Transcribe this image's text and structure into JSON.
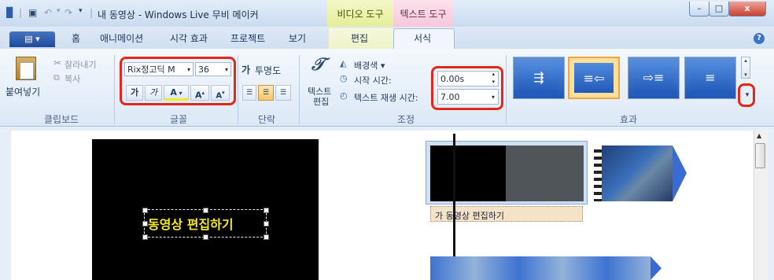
{
  "window": {
    "title": "내 동영상 - Windows Live 무비 메이커",
    "context_video": "비디오 도구",
    "context_text": "텍스트 도구",
    "min": "–",
    "max": "□",
    "close": "x"
  },
  "tabs": {
    "file": "▤ ▾",
    "home": "홈",
    "animation": "애니메이션",
    "visual_effects": "시각 효과",
    "project": "프로젝트",
    "view": "보기",
    "edit": "편집",
    "format": "서식",
    "help": "?"
  },
  "clipboard": {
    "paste": "붙여넣기",
    "cut": "잘라내기",
    "copy": "복사",
    "label": "클립보드"
  },
  "font": {
    "family": "Rix정고딕 M",
    "size": "36",
    "grow": "가",
    "shrink": "가",
    "color": "A",
    "increase": "A",
    "decrease": "A",
    "label": "글꼴"
  },
  "paragraph": {
    "transparency": "투명도",
    "label": "단락"
  },
  "adjust": {
    "text_edit_line1": "텍스트",
    "text_edit_line2": "편집",
    "background_color": "배경색 ▾",
    "start_time": "시작 시간:",
    "start_time_value": "0.00s",
    "duration": "텍스트 재생 시간:",
    "duration_value": "7.00",
    "label": "조정"
  },
  "effects": {
    "label": "효과"
  },
  "preview": {
    "caption": "동영상 편집하기"
  },
  "storyboard": {
    "caption_strip": "가 동영상 편집하기"
  },
  "colors": {
    "highlight_red": "#e3281b",
    "caption_yellow": "#f5e62a"
  }
}
